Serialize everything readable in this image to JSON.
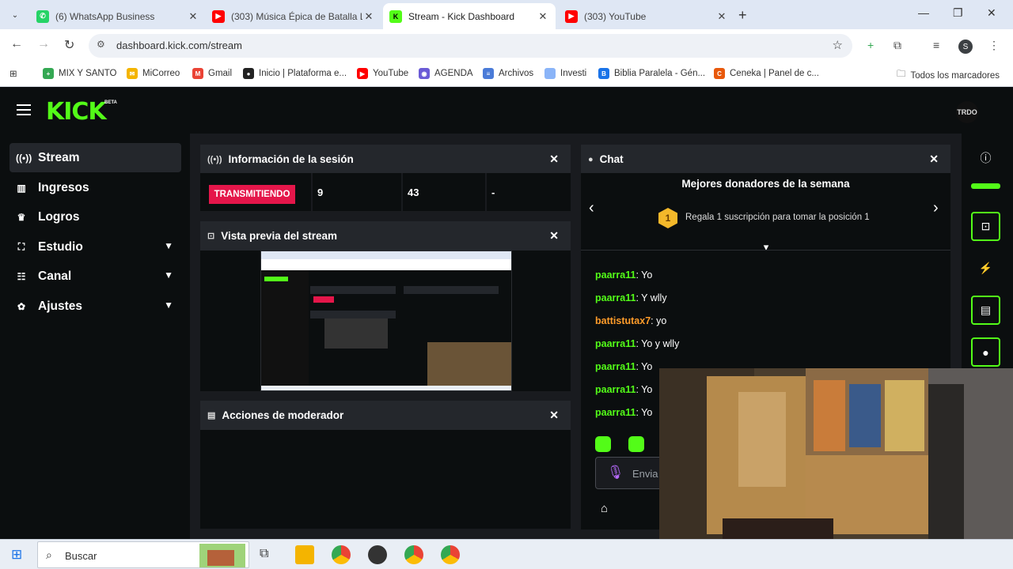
{
  "browser": {
    "tabs": [
      {
        "title": "(6) WhatsApp Business",
        "icon": "whatsapp-icon",
        "color": "#25d366"
      },
      {
        "title": "(303) Música Épica de Batalla Le",
        "icon": "youtube-icon",
        "color": "#ff0000"
      },
      {
        "title": "Stream - Kick Dashboard",
        "icon": "kick-icon",
        "color": "#53fc18"
      },
      {
        "title": "(303) YouTube",
        "icon": "youtube-icon",
        "color": "#ff0000"
      }
    ],
    "url": "dashboard.kick.com/stream",
    "profile_initial": "S",
    "bookmarks": [
      {
        "label": "MIX Y SANTO",
        "color": "#34a853"
      },
      {
        "label": "MiCorreo",
        "color": "#f4b400"
      },
      {
        "label": "Gmail",
        "color": "#ea4335"
      },
      {
        "label": "Inicio | Plataforma e...",
        "color": "#222222"
      },
      {
        "label": "YouTube",
        "color": "#ff0000"
      },
      {
        "label": "AGENDA",
        "color": "#6b5bd6"
      },
      {
        "label": "Archivos",
        "color": "#4a7bd8"
      },
      {
        "label": "Investi",
        "color": "#8ab4f8"
      },
      {
        "label": "Biblia Paralela - Gén...",
        "color": "#1a73e8"
      },
      {
        "label": "Ceneka | Panel de c...",
        "color": "#e8590c"
      }
    ],
    "all_bookmarks": "Todos los marcadores"
  },
  "kick": {
    "logo": "KICK",
    "logo_beta": "BETA",
    "avatar_text": "TRDO",
    "sidebar": [
      {
        "label": "Stream",
        "icon": "broadcast-icon"
      },
      {
        "label": "Ingresos",
        "icon": "chart-icon"
      },
      {
        "label": "Logros",
        "icon": "trophy-icon"
      },
      {
        "label": "Estudio",
        "icon": "studio-icon"
      },
      {
        "label": "Canal",
        "icon": "channel-icon"
      },
      {
        "label": "Ajustes",
        "icon": "settings-icon"
      }
    ],
    "session": {
      "title": "Información de la sesión",
      "status": "TRANSMITIENDO",
      "viewers": "9",
      "followers": "43",
      "extra": "-"
    },
    "preview_title": "Vista previa del stream",
    "mod_title": "Acciones de moderador",
    "chat": {
      "title": "Chat",
      "top_title": "Mejores donadores de la semana",
      "top_rank": "1",
      "top_sub": "Regala 1 suscripción para tomar la posición 1",
      "messages": [
        {
          "user": "paarra11",
          "text": " Yo"
        },
        {
          "user": "paarra11",
          "text": " Y wlly"
        },
        {
          "user": "battistutax7",
          "text": " yo"
        },
        {
          "user": "paarra11",
          "text": " Yo y wlly"
        },
        {
          "user": "paarra11",
          "text": " Yo"
        },
        {
          "user": "paarra11",
          "text": " Yo"
        },
        {
          "user": "paarra11",
          "text": " Yo"
        }
      ],
      "input_placeholder": "Envia"
    }
  },
  "taskbar": {
    "search": "Buscar"
  }
}
